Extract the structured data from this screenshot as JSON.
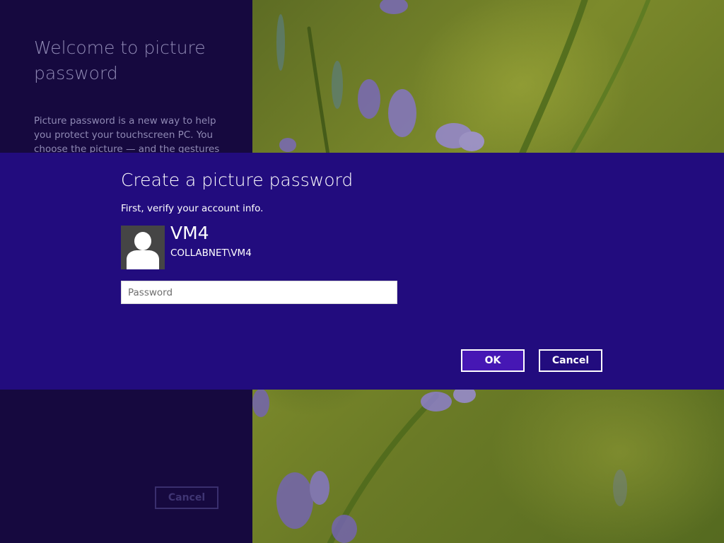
{
  "intro": {
    "title": "Welcome to picture password",
    "description": "Picture password is a new way to help you protect your touchscreen PC. You choose the picture — and the gestures",
    "cancel_label": "Cancel"
  },
  "dialog": {
    "title": "Create a picture password",
    "subtitle": "First, verify your account info.",
    "account": {
      "name": "VM4",
      "domain": "COLLABNET\\VM4",
      "avatar_icon": "user-silhouette-icon"
    },
    "password": {
      "placeholder": "Password",
      "value": ""
    },
    "ok_label": "OK",
    "cancel_label": "Cancel"
  },
  "colors": {
    "dialog_background": "#220c7e",
    "ok_button": "#4617b4",
    "intro_panel": "#16093f"
  }
}
